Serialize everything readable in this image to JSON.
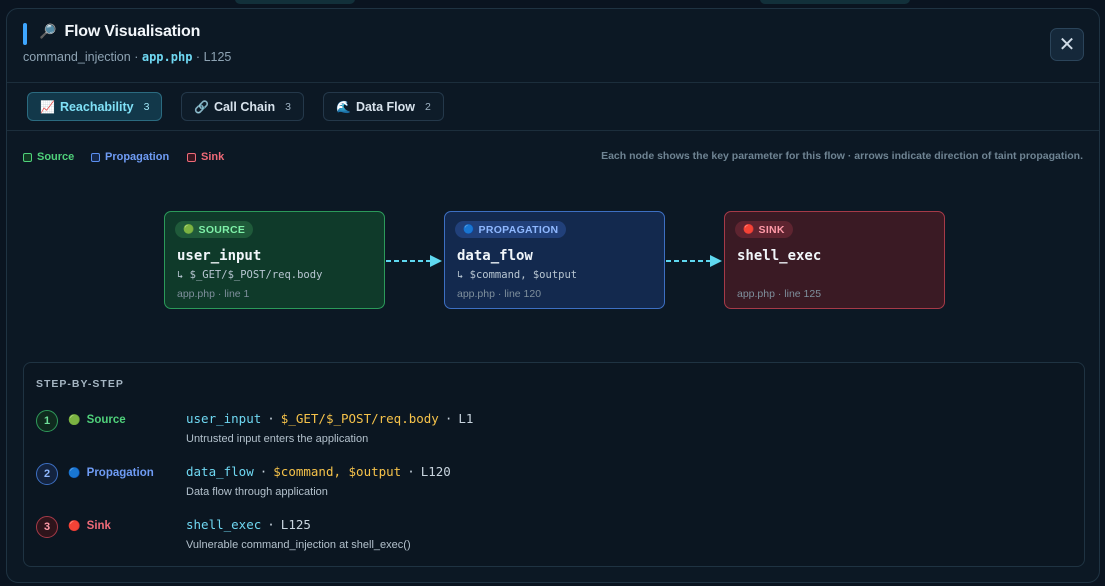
{
  "header": {
    "title_icon": "🔎",
    "title": "Flow Visualisation",
    "vuln_type": "command_injection",
    "sep1": "·",
    "file": "app.php",
    "sep2": "·",
    "line": "L125",
    "close_label": "✕"
  },
  "tabs": [
    {
      "icon": "📈",
      "label": "Reachability",
      "count": "3",
      "active": true
    },
    {
      "icon": "🔗",
      "label": "Call Chain",
      "count": "3",
      "active": false
    },
    {
      "icon": "🌊",
      "label": "Data Flow",
      "count": "2",
      "active": false
    }
  ],
  "legend": [
    {
      "label": "Source",
      "color": "#4fd07a"
    },
    {
      "label": "Propagation",
      "color": "#5b8ff0"
    },
    {
      "label": "Sink",
      "color": "#f06a78"
    }
  ],
  "hint": "Each node shows the key parameter for this flow · arrows indicate direction of taint propagation.",
  "nodes": [
    {
      "badge_icon": "🟢",
      "badge": "SOURCE",
      "name": "user_input",
      "param": "↳ $_GET/$_POST/req.body",
      "location": "app.php · line 1"
    },
    {
      "badge_icon": "🔵",
      "badge": "PROPAGATION",
      "name": "data_flow",
      "param": "↳ $command, $output",
      "location": "app.php · line 120"
    },
    {
      "badge_icon": "🔴",
      "badge": "SINK",
      "name": "shell_exec",
      "param": "",
      "location": "app.php · line 125"
    }
  ],
  "steps_title": "STEP-BY-STEP",
  "steps": [
    {
      "num": "1",
      "kind_icon": "🟢",
      "kind": "Source",
      "fn": "user_input",
      "dot": "·",
      "param": "$_GET/$_POST/req.body",
      "dot2": "·",
      "line": "L1",
      "desc": "Untrusted input enters the application"
    },
    {
      "num": "2",
      "kind_icon": "🔵",
      "kind": "Propagation",
      "fn": "data_flow",
      "dot": "·",
      "param": "$command, $output",
      "dot2": "·",
      "line": "L120",
      "desc": "Data flow through application"
    },
    {
      "num": "3",
      "kind_icon": "🔴",
      "kind": "Sink",
      "fn": "shell_exec",
      "dot": "·",
      "param": "",
      "dot2": "",
      "line": "L125",
      "desc": "Vulnerable command_injection at shell_exec()"
    }
  ],
  "colors": {
    "accent": "#3ea6ff",
    "arrow": "#5fd8f0",
    "source": "#4fd07a",
    "propagation": "#5b8ff0",
    "sink": "#f06a78"
  }
}
